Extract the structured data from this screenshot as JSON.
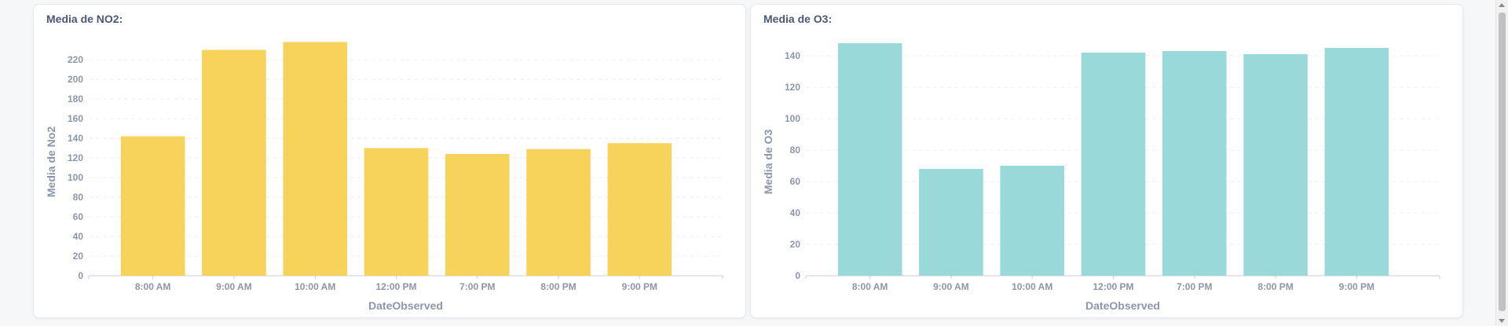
{
  "charts": [
    {
      "title": "Media de NO2:",
      "color": "#f7d35c"
    },
    {
      "title": "Media de O3:",
      "color": "#9ad9da"
    }
  ],
  "chart_data": [
    {
      "type": "bar",
      "title": "Media de NO2:",
      "xlabel": "DateObserved",
      "ylabel": "Media de No2",
      "categories": [
        "8:00 AM",
        "9:00 AM",
        "10:00 AM",
        "12:00 PM",
        "7:00 PM",
        "8:00 PM",
        "9:00 PM"
      ],
      "values": [
        142,
        230,
        238,
        130,
        124,
        129,
        135
      ],
      "yticks": [
        0,
        20,
        40,
        60,
        80,
        100,
        120,
        140,
        160,
        180,
        200,
        220
      ],
      "ylim": [
        0,
        240
      ],
      "grid": true,
      "color": "#f7d35c"
    },
    {
      "type": "bar",
      "title": "Media de O3:",
      "xlabel": "DateObserved",
      "ylabel": "Media de O3",
      "categories": [
        "8:00 AM",
        "9:00 AM",
        "10:00 AM",
        "12:00 PM",
        "7:00 PM",
        "8:00 PM",
        "9:00 PM"
      ],
      "values": [
        148,
        68,
        70,
        142,
        143,
        141,
        145
      ],
      "yticks": [
        0,
        20,
        40,
        60,
        80,
        100,
        120,
        140
      ],
      "ylim": [
        0,
        150
      ],
      "grid": true,
      "color": "#9ad9da"
    }
  ]
}
